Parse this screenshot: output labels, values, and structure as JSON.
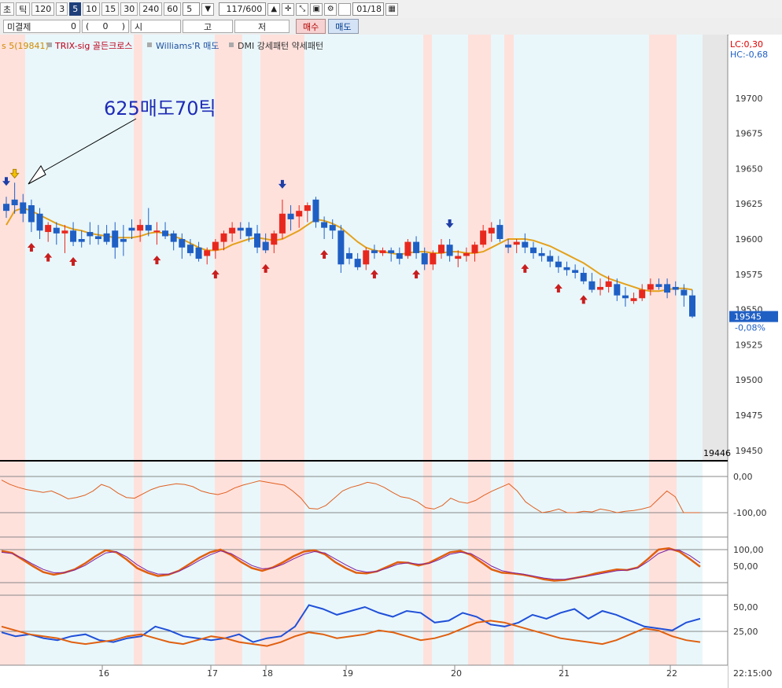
{
  "toolbar": {
    "type_cho": "초",
    "type_tick": "틱",
    "intervals": [
      "120",
      "3",
      "5",
      "10",
      "15",
      "30",
      "240",
      "60"
    ],
    "selected_interval": "5",
    "interval_select": "5",
    "count": "117/600",
    "date": "01/18"
  },
  "order_bar": {
    "unsettled_label": "미결제",
    "unsettled_value": "0",
    "paren_open": "(",
    "paren_value": "0",
    "paren_close": ")",
    "open_label": "시",
    "high_label": "고",
    "low_label": "저",
    "buy_label": "매수",
    "sell_label": "매도"
  },
  "legend": {
    "items": [
      {
        "text": "s 5(19841)",
        "color": "#d08a00"
      },
      {
        "text": "TRIX-sig 골든크로스",
        "color": "#c0001a"
      },
      {
        "text": "Williams'R 매도",
        "color": "#2050a0"
      },
      {
        "text": "DMI 강세패턴  약세패턴",
        "color": "#333333"
      }
    ],
    "lc": "LC:0,30",
    "hc": "HC:-0,68"
  },
  "annotation": "625매도70틱",
  "colors": {
    "up": "#e8281e",
    "down": "#1f5fc4",
    "ma": "#e4a11b",
    "bull_band": "#ffe1dc",
    "bear_band": "#e9f7fb",
    "annotation": "#1f2bb5"
  },
  "chart_data": [
    {
      "type": "candlestick",
      "title": "",
      "ylim": [
        19446,
        19725
      ],
      "y_ticks": [
        "19700",
        "19675",
        "19650",
        "19625",
        "19600",
        "19575",
        "19550",
        "19525",
        "19500",
        "19475",
        "19450"
      ],
      "x_labels": [
        "16",
        "17",
        "18",
        "19",
        "20",
        "21",
        "22"
      ],
      "time_label": "22:15:00",
      "current_price": "19545",
      "current_change": "-0,08%",
      "low_marker": "19446",
      "candles": [
        [
          19625,
          19630,
          19615,
          19620
        ],
        [
          19628,
          19640,
          19618,
          19624
        ],
        [
          19626,
          19632,
          19612,
          19618
        ],
        [
          19624,
          19628,
          19605,
          19612
        ],
        [
          19618,
          19622,
          19600,
          19606
        ],
        [
          19605,
          19612,
          19598,
          19610
        ],
        [
          19608,
          19612,
          19596,
          19604
        ],
        [
          19604,
          19610,
          19590,
          19606
        ],
        [
          19606,
          19612,
          19595,
          19598
        ],
        [
          19600,
          19606,
          19594,
          19598
        ],
        [
          19605,
          19612,
          19596,
          19602
        ],
        [
          19602,
          19610,
          19596,
          19600
        ],
        [
          19604,
          19610,
          19596,
          19598
        ],
        [
          19606,
          19612,
          19586,
          19594
        ],
        [
          19600,
          19610,
          19588,
          19598
        ],
        [
          19608,
          19614,
          19600,
          19606
        ],
        [
          19606,
          19614,
          19598,
          19610
        ],
        [
          19610,
          19622,
          19602,
          19606
        ],
        [
          19606,
          19612,
          19596,
          19606
        ],
        [
          19606,
          19612,
          19600,
          19602
        ],
        [
          19604,
          19606,
          19592,
          19598
        ],
        [
          19600,
          19604,
          19586,
          19594
        ],
        [
          19596,
          19600,
          19588,
          19590
        ],
        [
          19594,
          19598,
          19584,
          19586
        ],
        [
          19588,
          19594,
          19582,
          19592
        ],
        [
          19592,
          19600,
          19586,
          19598
        ],
        [
          19598,
          19606,
          19592,
          19604
        ],
        [
          19604,
          19612,
          19598,
          19608
        ],
        [
          19608,
          19612,
          19600,
          19606
        ],
        [
          19608,
          19612,
          19598,
          19602
        ],
        [
          19604,
          19610,
          19590,
          19594
        ],
        [
          19598,
          19604,
          19590,
          19592
        ],
        [
          19596,
          19606,
          19590,
          19604
        ],
        [
          19604,
          19628,
          19600,
          19618
        ],
        [
          19618,
          19624,
          19606,
          19614
        ],
        [
          19616,
          19624,
          19608,
          19620
        ],
        [
          19620,
          19626,
          19612,
          19624
        ],
        [
          19628,
          19630,
          19608,
          19612
        ],
        [
          19612,
          19616,
          19600,
          19608
        ],
        [
          19610,
          19614,
          19600,
          19606
        ],
        [
          19606,
          19610,
          19576,
          19582
        ],
        [
          19590,
          19594,
          19582,
          19586
        ],
        [
          19586,
          19590,
          19578,
          19580
        ],
        [
          19582,
          19594,
          19578,
          19592
        ],
        [
          19592,
          19596,
          19586,
          19590
        ],
        [
          19590,
          19594,
          19588,
          19592
        ],
        [
          19592,
          19594,
          19584,
          19590
        ],
        [
          19590,
          19594,
          19582,
          19586
        ],
        [
          19588,
          19600,
          19586,
          19598
        ],
        [
          19598,
          19602,
          19586,
          19590
        ],
        [
          19590,
          19594,
          19578,
          19582
        ],
        [
          19582,
          19592,
          19578,
          19590
        ],
        [
          19590,
          19600,
          19586,
          19596
        ],
        [
          19596,
          19600,
          19584,
          19588
        ],
        [
          19586,
          19592,
          19580,
          19588
        ],
        [
          19588,
          19594,
          19584,
          19590
        ],
        [
          19590,
          19598,
          19584,
          19596
        ],
        [
          19596,
          19610,
          19594,
          19606
        ],
        [
          19604,
          19612,
          19598,
          19608
        ],
        [
          19610,
          19614,
          19598,
          19600
        ],
        [
          19596,
          19600,
          19590,
          19594
        ],
        [
          19596,
          19600,
          19590,
          19598
        ],
        [
          19598,
          19604,
          19590,
          19594
        ],
        [
          19594,
          19598,
          19586,
          19590
        ],
        [
          19590,
          19594,
          19584,
          19588
        ],
        [
          19588,
          19592,
          19580,
          19584
        ],
        [
          19584,
          19588,
          19576,
          19580
        ],
        [
          19580,
          19584,
          19574,
          19578
        ],
        [
          19578,
          19582,
          19572,
          19576
        ],
        [
          19576,
          19580,
          19568,
          19570
        ],
        [
          19570,
          19576,
          19562,
          19564
        ],
        [
          19564,
          19572,
          19560,
          19566
        ],
        [
          19566,
          19574,
          19562,
          19570
        ],
        [
          19568,
          19572,
          19556,
          19560
        ],
        [
          19560,
          19566,
          19552,
          19558
        ],
        [
          19556,
          19562,
          19554,
          19558
        ],
        [
          19558,
          19568,
          19556,
          19564
        ],
        [
          19564,
          19572,
          19560,
          19568
        ],
        [
          19568,
          19572,
          19564,
          19566
        ],
        [
          19568,
          19572,
          19558,
          19562
        ],
        [
          19566,
          19570,
          19560,
          19564
        ],
        [
          19564,
          19568,
          19552,
          19560
        ],
        [
          19560,
          19564,
          19544,
          19545
        ]
      ],
      "ma_values": [
        19610,
        19620,
        19622,
        19620,
        19617,
        19614,
        19611,
        19609,
        19607,
        19606,
        19604,
        19603,
        19602,
        19601,
        19601,
        19601,
        19602,
        19604,
        19605,
        19604,
        19602,
        19600,
        19597,
        19594,
        19592,
        19592,
        19593,
        19596,
        19598,
        19600,
        19601,
        19600,
        19599,
        19600,
        19603,
        19606,
        19610,
        19614,
        19613,
        19611,
        19608,
        19603,
        19598,
        19594,
        19592,
        19591,
        19590,
        19589,
        19590,
        19591,
        19591,
        19590,
        19590,
        19591,
        19591,
        19590,
        19590,
        19591,
        19594,
        19597,
        19600,
        19600,
        19600,
        19599,
        19597,
        19595,
        19592,
        19589,
        19586,
        19583,
        19579,
        19575,
        19572,
        19570,
        19568,
        19566,
        19564,
        19563,
        19563,
        19564,
        19565,
        19565,
        19564
      ],
      "buy_arrows_at": [
        3,
        5,
        8,
        18,
        25,
        31,
        38,
        44,
        49,
        62,
        66,
        69
      ],
      "sell_arrows_at": [
        0,
        33,
        53
      ],
      "yellow_arrow_at": 1
    },
    {
      "type": "line",
      "name_right_ticks": [
        "0,00",
        "-100,00"
      ],
      "series": [
        {
          "values": [
            -10,
            -22,
            -30,
            -36,
            -40,
            -44,
            -40,
            -50,
            -62,
            -58,
            -52,
            -40,
            -22,
            -30,
            -46,
            -58,
            -60,
            -48,
            -36,
            -28,
            -24,
            -20,
            -22,
            -28,
            -40,
            -46,
            -50,
            -44,
            -32,
            -24,
            -18,
            -12,
            -16,
            -20,
            -24,
            -40,
            -60,
            -88,
            -90,
            -80,
            -60,
            -40,
            -30,
            -24,
            -16,
            -20,
            -30,
            -44,
            -56,
            -60,
            -70,
            -86,
            -90,
            -80,
            -60,
            -70,
            -74,
            -66,
            -52,
            -40,
            -30,
            -20,
            -40,
            -70,
            -86,
            -100,
            -96,
            -90,
            -100,
            -100,
            -96,
            -98,
            -90,
            -94,
            -100,
            -96,
            -94,
            -90,
            -84,
            -62,
            -40,
            -56,
            -100,
            -100,
            -100
          ]
        }
      ]
    },
    {
      "type": "line",
      "right_ticks": [
        "100,00",
        "50,00"
      ],
      "series": [
        {
          "name": "",
          "values": [
            96,
            90,
            70,
            50,
            32,
            24,
            30,
            40,
            58,
            80,
            98,
            92,
            70,
            44,
            30,
            20,
            24,
            36,
            56,
            76,
            92,
            100,
            84,
            62,
            44,
            36,
            46,
            62,
            80,
            94,
            98,
            86,
            62,
            44,
            30,
            28,
            34,
            48,
            62,
            60,
            52,
            60,
            76,
            92,
            96,
            84,
            62,
            40,
            30,
            28,
            24,
            18,
            10,
            6,
            8,
            14,
            20,
            28,
            34,
            40,
            38,
            46,
            72,
            100,
            104,
            94,
            72,
            48
          ]
        },
        {
          "name": "",
          "values": [
            92,
            88,
            74,
            56,
            40,
            30,
            30,
            38,
            52,
            72,
            90,
            94,
            78,
            54,
            36,
            26,
            26,
            34,
            50,
            68,
            84,
            96,
            88,
            70,
            52,
            42,
            44,
            56,
            72,
            86,
            94,
            90,
            72,
            54,
            38,
            32,
            34,
            44,
            56,
            60,
            56,
            58,
            70,
            86,
            92,
            88,
            70,
            50,
            36,
            30,
            26,
            20,
            14,
            10,
            10,
            14,
            18,
            24,
            30,
            36,
            38,
            44,
            64,
            88,
            100,
            98,
            82,
            60
          ]
        }
      ]
    },
    {
      "type": "line",
      "right_ticks": [
        "50,00",
        "25,00"
      ],
      "series": [
        {
          "name": "",
          "values": [
            24,
            20,
            22,
            18,
            16,
            20,
            22,
            16,
            14,
            18,
            20,
            30,
            26,
            20,
            18,
            16,
            18,
            22,
            14,
            18,
            20,
            30,
            52,
            48,
            42,
            46,
            50,
            44,
            40,
            46,
            44,
            34,
            36,
            44,
            40,
            32,
            30,
            34,
            42,
            38,
            44,
            48,
            38,
            46,
            42,
            36,
            30,
            28,
            26,
            34,
            38
          ]
        },
        {
          "name": "",
          "values": [
            30,
            26,
            22,
            20,
            18,
            14,
            12,
            14,
            16,
            20,
            22,
            18,
            14,
            12,
            16,
            20,
            18,
            14,
            12,
            10,
            14,
            20,
            24,
            22,
            18,
            20,
            22,
            26,
            24,
            20,
            16,
            18,
            22,
            28,
            34,
            36,
            34,
            30,
            26,
            22,
            18,
            16,
            14,
            12,
            16,
            22,
            28,
            26,
            20,
            16,
            14
          ]
        }
      ]
    }
  ]
}
